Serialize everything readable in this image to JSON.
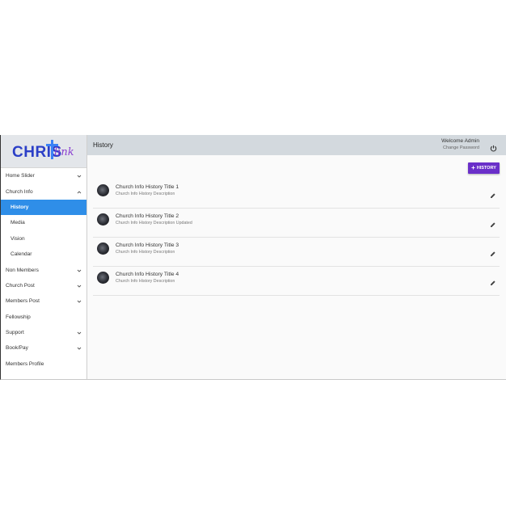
{
  "brand": {
    "logo_main": "CHRIS",
    "logo_script": "link"
  },
  "sidebar": {
    "items": [
      {
        "label": "Home Slider",
        "chevron": "down"
      },
      {
        "label": "Church Info",
        "chevron": "up"
      },
      {
        "label": "History",
        "sub": true,
        "active": true
      },
      {
        "label": "Media",
        "sub": true
      },
      {
        "label": "Vision",
        "sub": true
      },
      {
        "label": "Calendar",
        "sub": true
      },
      {
        "label": "Non Members",
        "chevron": "down"
      },
      {
        "label": "Church Post",
        "chevron": "down"
      },
      {
        "label": "Members Post",
        "chevron": "down"
      },
      {
        "label": "Fellowship"
      },
      {
        "label": "Support",
        "chevron": "down"
      },
      {
        "label": "Book/Pay",
        "chevron": "down"
      },
      {
        "label": "Members Profile"
      }
    ]
  },
  "header": {
    "title": "History",
    "welcome": "Welcome Admin",
    "change_password": "Change Password",
    "power_icon": "power-icon"
  },
  "toolbar": {
    "add_label": "HISTORY",
    "add_icon": "plus-icon"
  },
  "list": {
    "items": [
      {
        "title": "Church Info History Title 1",
        "description": "Church Info History Description"
      },
      {
        "title": "Church Info History Title 2",
        "description": "Church Info History Description Updated"
      },
      {
        "title": "Church Info History Title 3",
        "description": "Church Info History Description"
      },
      {
        "title": "Church Info History Title 4",
        "description": "Church Info History Description"
      }
    ]
  },
  "colors": {
    "accent": "#6a2fc9",
    "active_nav": "#2f8ee8",
    "topbar": "#d3d9de"
  }
}
